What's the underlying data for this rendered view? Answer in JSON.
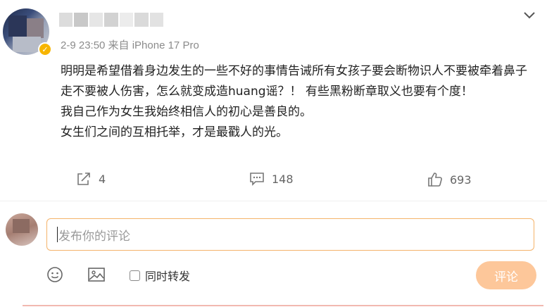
{
  "post": {
    "meta": "2-9 23:50 来自 iPhone 17 Pro",
    "lines": [
      "明明是希望借着身边发生的一些不好的事情告诫所有女孩子要会断物识人不要被牵着鼻子走不要被人伤害，怎么就变成造huang谣？！ 有些黑粉断章取义也要有个度！",
      "我自己作为女生我始终相信人的初心是善良的。",
      "女生们之间的互相托举，才是最戳人的光。"
    ]
  },
  "actions": {
    "share_count": "4",
    "comment_count": "148",
    "like_count": "693"
  },
  "composer": {
    "placeholder": "发布你的评论",
    "forward_label": "同时转发",
    "submit_label": "评论"
  },
  "icons": {
    "vip_badge": "verified-badge-icon",
    "chevron": "chevron-down-icon",
    "share": "share-icon",
    "comment": "comment-icon",
    "like": "thumbs-up-icon",
    "emoji": "emoji-icon",
    "image": "image-icon"
  },
  "colors": {
    "accent": "#f5b36a",
    "submit_button": "#fdc79a",
    "meta_text": "#8b8b8b",
    "vip_badge": "#f7b500"
  }
}
